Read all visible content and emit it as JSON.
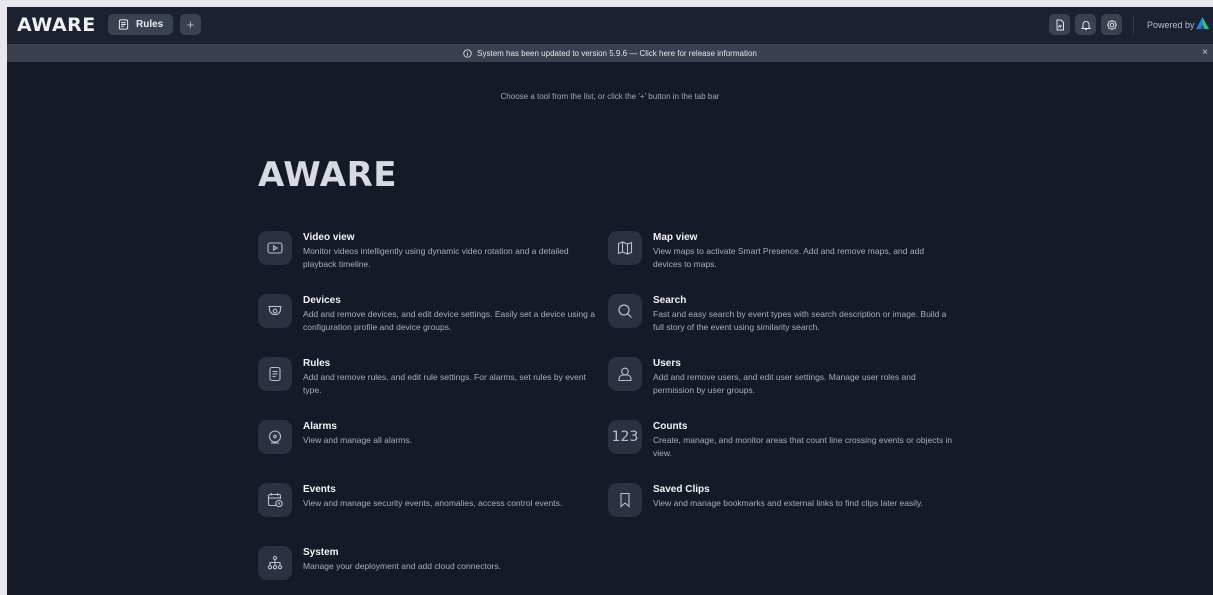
{
  "header": {
    "logo": "AWARE",
    "active_tab": "Rules",
    "add_tab": "+",
    "powered_by": "Powered by",
    "icons": [
      "report-icon",
      "bell-icon",
      "gear-icon"
    ]
  },
  "banner": {
    "message": "System has been updated to version 5.9.6 — Click here for release information",
    "close": "×"
  },
  "main": {
    "hint": "Choose a tool from the list, or click the '+' button in the tab bar",
    "title": "AWARE",
    "tools": [
      {
        "name": "Video view",
        "icon": "video-icon",
        "description": "Monitor videos intelligently using dynamic video rotation and a detailed playback timeline."
      },
      {
        "name": "Map view",
        "icon": "map-icon",
        "description": "View maps to activate Smart Presence. Add and remove maps, and add devices to maps."
      },
      {
        "name": "Devices",
        "icon": "camera-icon",
        "description": "Add and remove devices, and edit device settings. Easily set a device using a configuration profile and device groups."
      },
      {
        "name": "Search",
        "icon": "search-icon",
        "description": "Fast and easy search by event types with search description or image. Build a full story of the event using similarity search."
      },
      {
        "name": "Rules",
        "icon": "rules-icon",
        "description": "Add and remove rules, and edit rule settings. For alarms, set rules by event type."
      },
      {
        "name": "Users",
        "icon": "user-icon",
        "description": "Add and remove users, and edit user settings. Manage user roles and permission by user groups."
      },
      {
        "name": "Alarms",
        "icon": "alarm-icon",
        "description": "View and manage all alarms."
      },
      {
        "name": "Counts",
        "icon": "counts-icon",
        "icon_text": "123",
        "description": "Create, manage, and monitor areas that count line crossing events or objects in view."
      },
      {
        "name": "Events",
        "icon": "events-icon",
        "description": "View and manage security events, anomalies, access control events."
      },
      {
        "name": "Saved Clips",
        "icon": "bookmark-icon",
        "description": "View and manage bookmarks and external links to find clips later easily."
      },
      {
        "name": "System",
        "icon": "system-icon",
        "description": "Manage your deployment and add cloud connectors."
      }
    ]
  },
  "colors": {
    "background": "#151a27",
    "topbar": "#1b2130",
    "banner": "#3a404f",
    "icon_box": "#2b3140",
    "brand_blue": "#2f7bd9",
    "brand_green": "#2fbf7a"
  }
}
